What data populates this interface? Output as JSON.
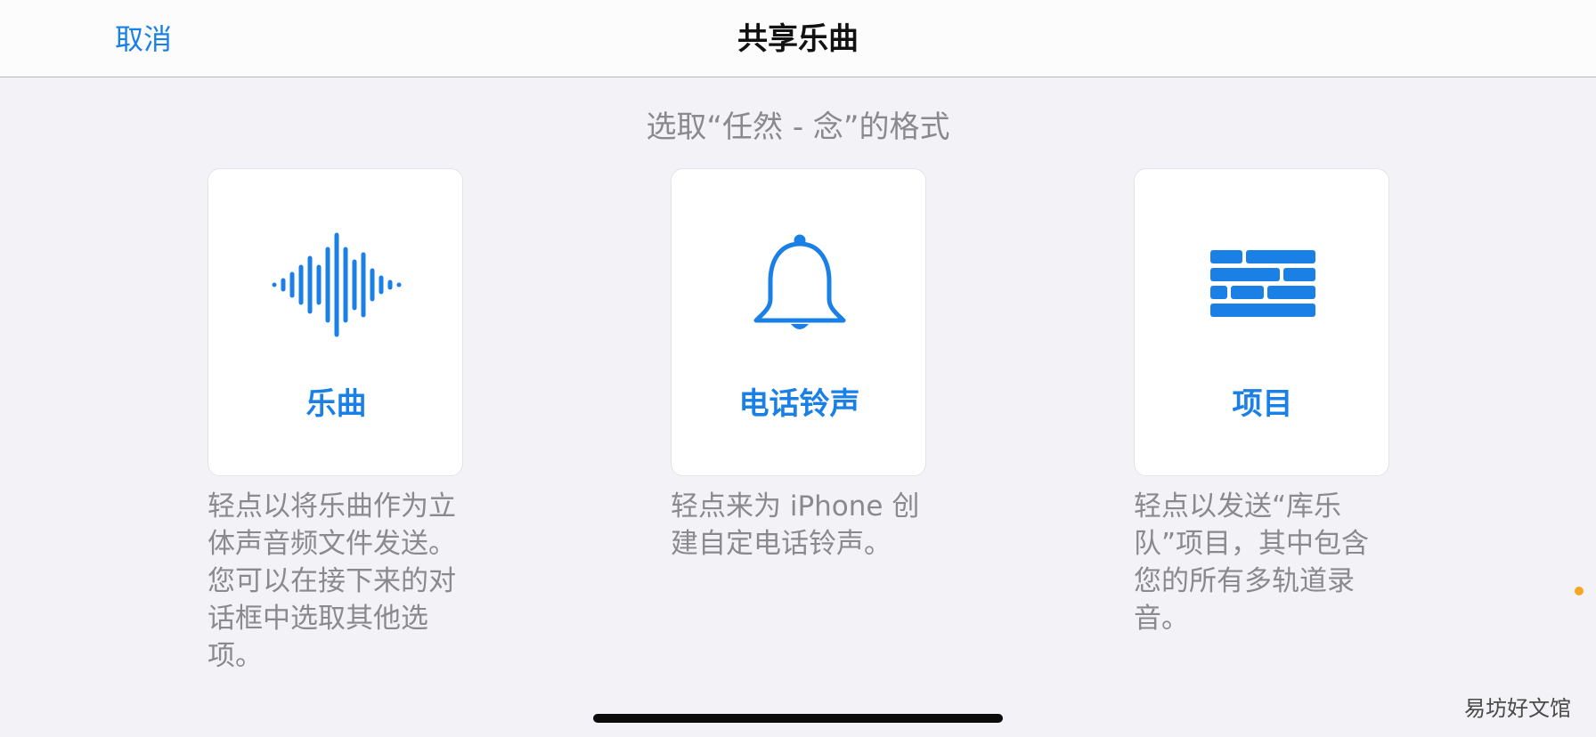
{
  "navbar": {
    "cancel_label": "取消",
    "title": "共享乐曲"
  },
  "subtitle": "选取“任然 - 念”的格式",
  "options": [
    {
      "label": "乐曲",
      "icon": "waveform-icon",
      "description": "轻点以将乐曲作为立体声音频文件发送。您可以在接下来的对话框中选取其他选项。"
    },
    {
      "label": "电话铃声",
      "icon": "bell-icon",
      "description": "轻点来为 iPhone 创建自定电话铃声。"
    },
    {
      "label": "项目",
      "icon": "bricks-icon",
      "description": "轻点以发送“库乐队”项目，其中包含您的所有多轨道录音。"
    }
  ],
  "watermark": "易坊好文馆",
  "colors": {
    "accent": "#1a80e6",
    "background": "#f2f2f7",
    "card": "#ffffff",
    "secondary_text": "#8a8a8e"
  }
}
